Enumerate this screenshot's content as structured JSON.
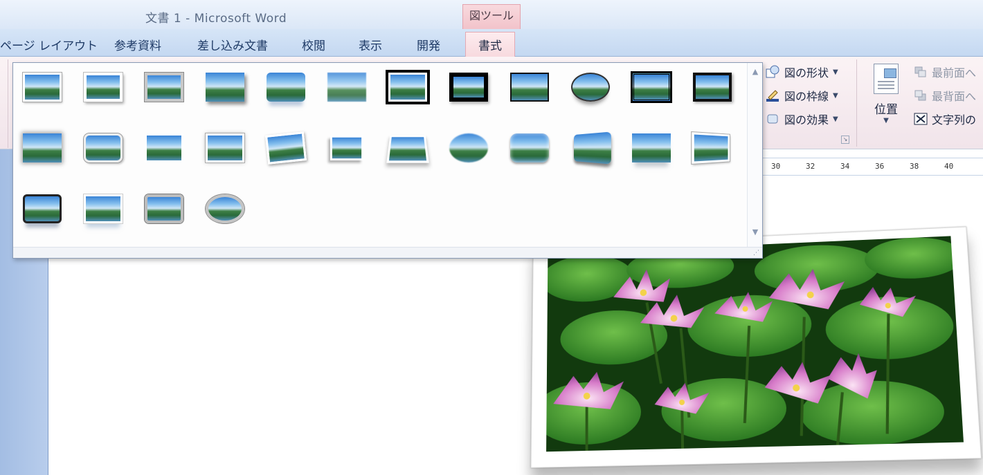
{
  "window": {
    "title": "文書 1 - Microsoft Word",
    "context_tab_group": "図ツール"
  },
  "tabs": [
    {
      "label": "ページ レイアウト"
    },
    {
      "label": "参考資料"
    },
    {
      "label": "差し込み文書"
    },
    {
      "label": "校閲"
    },
    {
      "label": "表示"
    },
    {
      "label": "開発"
    },
    {
      "label": "書式",
      "active": true
    }
  ],
  "ribbon": {
    "picture_styles": {
      "shape": "図の形状",
      "border": "図の枠線",
      "effects": "図の効果"
    },
    "arrange": {
      "position": "位置",
      "bring_front": "最前面へ",
      "send_back": "最背面へ",
      "text_wrap": "文字列の"
    }
  },
  "ruler": {
    "ticks": [
      "30",
      "32",
      "34",
      "36",
      "38",
      "40"
    ]
  },
  "gallery": {
    "style_count": 28
  },
  "colors": {
    "ribbon_blue": "#c4d8f1",
    "context_pink": "#f5cdd4",
    "doc_margin": "#a3bde3"
  }
}
